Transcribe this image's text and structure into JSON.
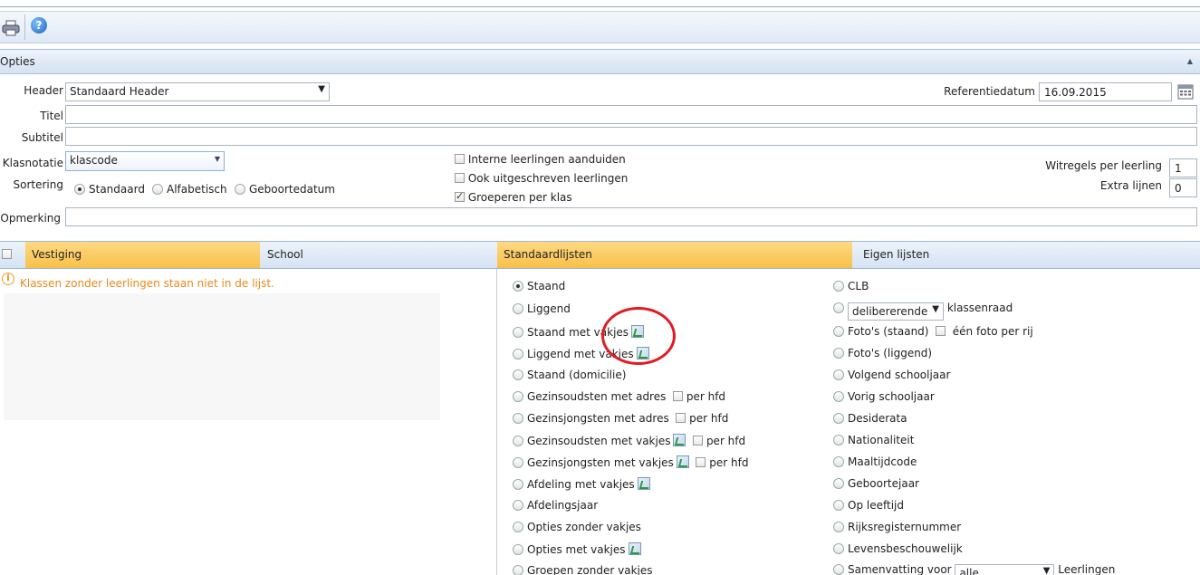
{
  "toolbar": {
    "print_icon": "printer-icon",
    "help_icon": "help-icon",
    "help_glyph": "?"
  },
  "opties": {
    "title": "Opties"
  },
  "form": {
    "header_label": "Header",
    "header_value": "Standaard Header",
    "titel_label": "Titel",
    "titel_value": "",
    "subtitel_label": "Subtitel",
    "subtitel_value": "",
    "klasnotatie_label": "Klasnotatie",
    "klasnotatie_value": "klascode",
    "sortering_label": "Sortering",
    "sortering_options": [
      "Standaard",
      "Alfabetisch",
      "Geboortedatum"
    ],
    "opmerking_label": "Opmerking",
    "opmerking_value": "",
    "checks": [
      "Interne leerlingen aanduiden",
      "Ook uitgeschreven leerlingen",
      "Groeperen per klas"
    ],
    "referentiedatum_label": "Referentiedatum",
    "referentiedatum_value": "16.09.2015",
    "witregels_label": "Witregels per leerling",
    "witregels_value": "1",
    "extra_label": "Extra lijnen",
    "extra_value": "0"
  },
  "tabs": {
    "vestiging": "Vestiging",
    "school": "School",
    "standaard": "Standaardlijsten",
    "eigen": "Eigen lijsten"
  },
  "warning": "Klassen zonder leerlingen staan niet in de lijst.",
  "left_options": {
    "staand": "Staand",
    "liggend": "Liggend",
    "staand_vakjes": "Staand met vakjes",
    "liggend_vakjes": "Liggend met vakjes",
    "staand_domicilie": "Staand (domicilie)",
    "gez_oud_adres": "Gezinsoudsten met adres",
    "gez_jong_adres": "Gezinsjongsten met adres",
    "gez_oud_vakjes": "Gezinsoudsten met vakjes",
    "gez_jong_vakjes": "Gezinsjongsten met vakjes",
    "afdeling_vakjes": "Afdeling met vakjes",
    "afdelingsjaar": "Afdelingsjaar",
    "opties_zonder": "Opties zonder vakjes",
    "opties_met": "Opties met vakjes",
    "groepen_zonder": "Groepen zonder vakjes",
    "per_hfd": "per hfd"
  },
  "right_options": {
    "clb": "CLB",
    "delib_value": "delibererende",
    "klassenraad": "klassenraad",
    "fotos_staand": "Foto's (staand)",
    "een_foto": "één foto per rij",
    "fotos_liggend": "Foto's (liggend)",
    "volgend": "Volgend schooljaar",
    "vorig": "Vorig schooljaar",
    "desiderata": "Desiderata",
    "nationaliteit": "Nationaliteit",
    "maaltijdcode": "Maaltijdcode",
    "geboortejaar": "Geboortejaar",
    "op_leeftijd": "Op leeftijd",
    "rijksregister": "Rijksregisternummer",
    "levens": "Levensbeschouwelijk",
    "samenvatting": "Samenvatting voor",
    "samenvatting_value": "alle",
    "leerlingen": "Leerlingen"
  }
}
